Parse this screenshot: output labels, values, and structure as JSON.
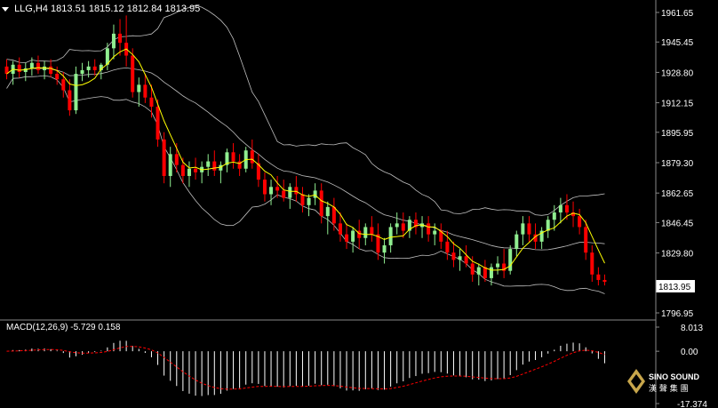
{
  "header": {
    "symbol": "LLG,H4",
    "open": "1813.51",
    "high": "1815.12",
    "low": "1812.84",
    "close": "1813.95"
  },
  "macd": {
    "label": "MACD(12,26,9)",
    "main": "-5.729",
    "signal": "0.158",
    "axis_ticks": [
      "8.013",
      "0.00",
      "-17.374"
    ]
  },
  "price_axis": {
    "ticks": [
      "1961.65",
      "1945.45",
      "1928.80",
      "1912.15",
      "1895.95",
      "1879.30",
      "1862.65",
      "1846.45",
      "1829.80",
      "1813.95",
      "1796.95"
    ],
    "current": "1813.95"
  },
  "logo": {
    "line1": "SINO SOUND",
    "line2": "漢 聲 集 團"
  },
  "colors": {
    "background": "#000000",
    "bull": "#90ee90",
    "bear": "#ff0000",
    "bands": "#bfbfbf",
    "ma": "#ffff00",
    "macd_hist": "#ffffff",
    "macd_signal": "#ff0000"
  },
  "chart_data": {
    "type": "candlestick",
    "instrument": "LLG",
    "timeframe": "H4",
    "ylim": [
      1796.95,
      1961.65
    ],
    "ohlc": [
      [
        1932,
        1936,
        1925,
        1928
      ],
      [
        1928,
        1935,
        1922,
        1933
      ],
      [
        1933,
        1937,
        1926,
        1929
      ],
      [
        1929,
        1934,
        1924,
        1931
      ],
      [
        1931,
        1937,
        1927,
        1934
      ],
      [
        1934,
        1938,
        1928,
        1930
      ],
      [
        1930,
        1935,
        1925,
        1932
      ],
      [
        1932,
        1936,
        1926,
        1928
      ],
      [
        1928,
        1932,
        1922,
        1925
      ],
      [
        1925,
        1929,
        1915,
        1919
      ],
      [
        1919,
        1925,
        1905,
        1908
      ],
      [
        1908,
        1932,
        1906,
        1928
      ],
      [
        1928,
        1934,
        1924,
        1930
      ],
      [
        1930,
        1935,
        1926,
        1932
      ],
      [
        1932,
        1936,
        1927,
        1930
      ],
      [
        1930,
        1934,
        1925,
        1933
      ],
      [
        1933,
        1945,
        1930,
        1942
      ],
      [
        1942,
        1955,
        1936,
        1950
      ],
      [
        1950,
        1958,
        1938,
        1945
      ],
      [
        1945,
        1960,
        1932,
        1938
      ],
      [
        1938,
        1942,
        1915,
        1918
      ],
      [
        1918,
        1926,
        1910,
        1922
      ],
      [
        1922,
        1928,
        1912,
        1915
      ],
      [
        1915,
        1922,
        1904,
        1910
      ],
      [
        1910,
        1914,
        1888,
        1892
      ],
      [
        1892,
        1896,
        1868,
        1872
      ],
      [
        1872,
        1888,
        1866,
        1884
      ],
      [
        1884,
        1890,
        1874,
        1878
      ],
      [
        1878,
        1882,
        1868,
        1872
      ],
      [
        1872,
        1880,
        1866,
        1876
      ],
      [
        1876,
        1882,
        1870,
        1874
      ],
      [
        1874,
        1880,
        1868,
        1877
      ],
      [
        1877,
        1884,
        1872,
        1880
      ],
      [
        1880,
        1886,
        1872,
        1875
      ],
      [
        1875,
        1880,
        1868,
        1878
      ],
      [
        1878,
        1887,
        1874,
        1885
      ],
      [
        1885,
        1890,
        1876,
        1880
      ],
      [
        1880,
        1884,
        1872,
        1876
      ],
      [
        1876,
        1888,
        1874,
        1886
      ],
      [
        1886,
        1892,
        1876,
        1879
      ],
      [
        1879,
        1884,
        1866,
        1870
      ],
      [
        1870,
        1874,
        1858,
        1862
      ],
      [
        1862,
        1870,
        1856,
        1866
      ],
      [
        1866,
        1872,
        1860,
        1864
      ],
      [
        1864,
        1870,
        1858,
        1860
      ],
      [
        1860,
        1868,
        1854,
        1866
      ],
      [
        1866,
        1872,
        1858,
        1862
      ],
      [
        1862,
        1866,
        1852,
        1856
      ],
      [
        1856,
        1862,
        1850,
        1860
      ],
      [
        1860,
        1868,
        1856,
        1864
      ],
      [
        1864,
        1868,
        1846,
        1850
      ],
      [
        1850,
        1858,
        1840,
        1855
      ],
      [
        1855,
        1860,
        1842,
        1846
      ],
      [
        1846,
        1852,
        1836,
        1840
      ],
      [
        1840,
        1846,
        1832,
        1836
      ],
      [
        1836,
        1844,
        1830,
        1842
      ],
      [
        1842,
        1848,
        1832,
        1838
      ],
      [
        1838,
        1846,
        1834,
        1844
      ],
      [
        1844,
        1850,
        1836,
        1840
      ],
      [
        1840,
        1846,
        1826,
        1830
      ],
      [
        1830,
        1838,
        1824,
        1834
      ],
      [
        1834,
        1846,
        1830,
        1844
      ],
      [
        1844,
        1852,
        1840,
        1846
      ],
      [
        1846,
        1852,
        1838,
        1842
      ],
      [
        1842,
        1850,
        1838,
        1848
      ],
      [
        1848,
        1852,
        1840,
        1844
      ],
      [
        1844,
        1850,
        1838,
        1846
      ],
      [
        1846,
        1850,
        1836,
        1840
      ],
      [
        1840,
        1846,
        1834,
        1842
      ],
      [
        1842,
        1846,
        1832,
        1836
      ],
      [
        1836,
        1842,
        1826,
        1830
      ],
      [
        1830,
        1836,
        1822,
        1826
      ],
      [
        1826,
        1832,
        1820,
        1828
      ],
      [
        1828,
        1834,
        1822,
        1824
      ],
      [
        1824,
        1828,
        1814,
        1818
      ],
      [
        1818,
        1824,
        1812,
        1822
      ],
      [
        1822,
        1826,
        1814,
        1816
      ],
      [
        1816,
        1824,
        1812,
        1822
      ],
      [
        1822,
        1828,
        1818,
        1824
      ],
      [
        1824,
        1832,
        1816,
        1820
      ],
      [
        1820,
        1834,
        1818,
        1832
      ],
      [
        1832,
        1842,
        1828,
        1840
      ],
      [
        1840,
        1850,
        1834,
        1846
      ],
      [
        1846,
        1850,
        1836,
        1840
      ],
      [
        1840,
        1846,
        1832,
        1836
      ],
      [
        1836,
        1844,
        1832,
        1842
      ],
      [
        1842,
        1850,
        1838,
        1848
      ],
      [
        1848,
        1856,
        1842,
        1852
      ],
      [
        1852,
        1860,
        1846,
        1856
      ],
      [
        1856,
        1862,
        1848,
        1852
      ],
      [
        1852,
        1858,
        1844,
        1850
      ],
      [
        1850,
        1854,
        1840,
        1844
      ],
      [
        1844,
        1848,
        1826,
        1830
      ],
      [
        1830,
        1834,
        1814,
        1818
      ],
      [
        1818,
        1822,
        1812,
        1815
      ],
      [
        1815,
        1818,
        1812,
        1813.95
      ]
    ]
  }
}
